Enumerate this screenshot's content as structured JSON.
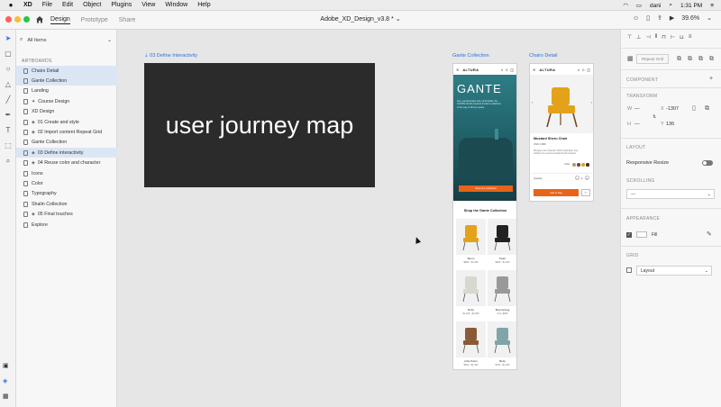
{
  "menubar": {
    "app": "XD",
    "items": [
      "File",
      "Edit",
      "Object",
      "Plugins",
      "View",
      "Window",
      "Help"
    ],
    "user": "dani",
    "clock": "1:31 PM"
  },
  "window": {
    "tabs": [
      "Design",
      "Prototype",
      "Share"
    ],
    "doc_title": "Adobe_XD_Design_v3.8 *",
    "zoom": "39.6%"
  },
  "layers": {
    "filter": "All Items",
    "section": "ARTBOARDS",
    "items": [
      {
        "label": "Chairs Detail",
        "type": "file",
        "sel": true
      },
      {
        "label": "Gante Collection",
        "type": "file",
        "sel": true
      },
      {
        "label": "Landing",
        "type": "file",
        "sel": false
      },
      {
        "label": "Course Design",
        "type": "star",
        "sel": false
      },
      {
        "label": "XD Design",
        "type": "file",
        "sel": false
      },
      {
        "label": "01 Create and style",
        "type": "comp",
        "sel": false
      },
      {
        "label": "02 Import content Repeat Grid",
        "type": "comp",
        "sel": false
      },
      {
        "label": "Gante Collection",
        "type": "file",
        "sel": false
      },
      {
        "label": "03 Define interactivity",
        "type": "comp",
        "sel": true
      },
      {
        "label": "04 Reuse color and character",
        "type": "comp",
        "sel": false
      },
      {
        "label": "Icons",
        "type": "file",
        "sel": false
      },
      {
        "label": "Color",
        "type": "file",
        "sel": false
      },
      {
        "label": "Typography",
        "type": "file",
        "sel": false
      },
      {
        "label": "Shalin Collection",
        "type": "file",
        "sel": false
      },
      {
        "label": "05 Final touches",
        "type": "comp",
        "sel": false
      },
      {
        "label": "Explore",
        "type": "file",
        "sel": false
      }
    ]
  },
  "canvas": {
    "artboard1_label": "03 Define Interactivity",
    "artboard1_text": "user journey map",
    "artboard2_label": "Gante Collection",
    "artboard3_label": "Chairs Detail",
    "brand": "ALTURA",
    "hero_title": "GANTE",
    "hero_body": "Hey, sophisticated and comfortable, the GANTE Nordic-inspired furniture collection is the way to fill any space.",
    "hero_button": "Shop the collection",
    "shop_heading": "Shop the Gante Collection",
    "products": [
      {
        "name": "Sheru",
        "price": "$800 - $1,300"
      },
      {
        "name": "Pearl",
        "price": "$900 - $1,200"
      },
      {
        "name": "Ruby",
        "price": "$1,400 - $1,800"
      },
      {
        "name": "Boomerang",
        "price": "from $690"
      },
      {
        "name": "Little Pietro",
        "price": "$500 - $1,400"
      },
      {
        "name": "Betty",
        "price": "$700 - $1,300"
      }
    ],
    "detail_title": "Mustard Sheru Chair",
    "detail_price": "USD 1,800",
    "detail_desc": "Bringing a rich collection 100% sustainable. Fine crafted to be environmentally friendly solutions.",
    "detail_color_label": "Color",
    "detail_qty_label": "Quantity",
    "detail_qty": "1",
    "detail_button": "Add to bag"
  },
  "props": {
    "repeat_grid": "Repeat Grid",
    "component": "COMPONENT",
    "transform": "TRANSFORM",
    "w_label": "W",
    "w_value": "—",
    "h_label": "H",
    "h_value": "—",
    "x_label": "X",
    "x_value": "-1307",
    "y_label": "Y",
    "y_value": "136",
    "layout": "LAYOUT",
    "responsive": "Responsive Resize",
    "scrolling": "SCROLLING",
    "scroll_value": "---",
    "appearance": "APPEARANCE",
    "fill": "Fill",
    "grid": "GRID",
    "grid_value": "Layout"
  },
  "colors": {
    "accent": "#2d72d9",
    "orange": "#e8631a",
    "teal": "#2e7d86",
    "mustard": "#e3a21a"
  }
}
